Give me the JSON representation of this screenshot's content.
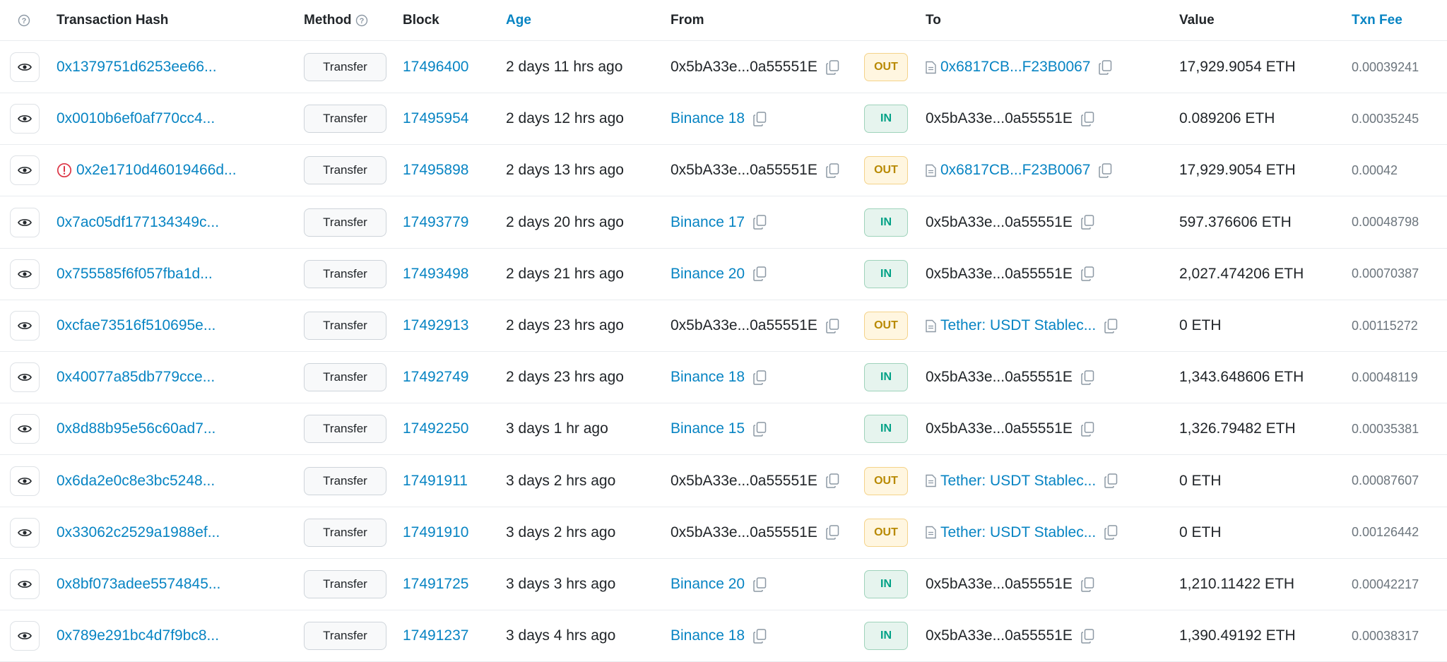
{
  "header": {
    "help_icon": "question-circle-icon",
    "hash": "Transaction Hash",
    "method": "Method",
    "block": "Block",
    "age": "Age",
    "from": "From",
    "to": "To",
    "value": "Value",
    "fee": "Txn Fee"
  },
  "colors": {
    "link": "#0784c3",
    "out": "#b88900",
    "in": "#00a186",
    "error": "#dc3545"
  },
  "rows": [
    {
      "hash": "0x1379751d6253ee66...",
      "error": false,
      "method": "Transfer",
      "block": "17496400",
      "age": "2 days 11 hrs ago",
      "from": "0x5bA33e...0a55551E",
      "from_link": false,
      "dir": "OUT",
      "to": "0x6817CB...F23B0067",
      "to_contract": true,
      "to_link": true,
      "value": "17,929.9054 ETH",
      "fee": "0.00039241"
    },
    {
      "hash": "0x0010b6ef0af770cc4...",
      "error": false,
      "method": "Transfer",
      "block": "17495954",
      "age": "2 days 12 hrs ago",
      "from": "Binance 18",
      "from_link": true,
      "dir": "IN",
      "to": "0x5bA33e...0a55551E",
      "to_contract": false,
      "to_link": false,
      "value": "0.089206 ETH",
      "fee": "0.00035245"
    },
    {
      "hash": "0x2e1710d46019466d...",
      "error": true,
      "method": "Transfer",
      "block": "17495898",
      "age": "2 days 13 hrs ago",
      "from": "0x5bA33e...0a55551E",
      "from_link": false,
      "dir": "OUT",
      "to": "0x6817CB...F23B0067",
      "to_contract": true,
      "to_link": true,
      "value": "17,929.9054 ETH",
      "fee": "0.00042"
    },
    {
      "hash": "0x7ac05df177134349c...",
      "error": false,
      "method": "Transfer",
      "block": "17493779",
      "age": "2 days 20 hrs ago",
      "from": "Binance 17",
      "from_link": true,
      "dir": "IN",
      "to": "0x5bA33e...0a55551E",
      "to_contract": false,
      "to_link": false,
      "value": "597.376606 ETH",
      "fee": "0.00048798"
    },
    {
      "hash": "0x755585f6f057fba1d...",
      "error": false,
      "method": "Transfer",
      "block": "17493498",
      "age": "2 days 21 hrs ago",
      "from": "Binance 20",
      "from_link": true,
      "dir": "IN",
      "to": "0x5bA33e...0a55551E",
      "to_contract": false,
      "to_link": false,
      "value": "2,027.474206 ETH",
      "fee": "0.00070387"
    },
    {
      "hash": "0xcfae73516f510695e...",
      "error": false,
      "method": "Transfer",
      "block": "17492913",
      "age": "2 days 23 hrs ago",
      "from": "0x5bA33e...0a55551E",
      "from_link": false,
      "dir": "OUT",
      "to": "Tether: USDT Stablec...",
      "to_contract": true,
      "to_link": true,
      "value": "0 ETH",
      "fee": "0.00115272"
    },
    {
      "hash": "0x40077a85db779cce...",
      "error": false,
      "method": "Transfer",
      "block": "17492749",
      "age": "2 days 23 hrs ago",
      "from": "Binance 18",
      "from_link": true,
      "dir": "IN",
      "to": "0x5bA33e...0a55551E",
      "to_contract": false,
      "to_link": false,
      "value": "1,343.648606 ETH",
      "fee": "0.00048119"
    },
    {
      "hash": "0x8d88b95e56c60ad7...",
      "error": false,
      "method": "Transfer",
      "block": "17492250",
      "age": "3 days 1 hr ago",
      "from": "Binance 15",
      "from_link": true,
      "dir": "IN",
      "to": "0x5bA33e...0a55551E",
      "to_contract": false,
      "to_link": false,
      "value": "1,326.79482 ETH",
      "fee": "0.00035381"
    },
    {
      "hash": "0x6da2e0c8e3bc5248...",
      "error": false,
      "method": "Transfer",
      "block": "17491911",
      "age": "3 days 2 hrs ago",
      "from": "0x5bA33e...0a55551E",
      "from_link": false,
      "dir": "OUT",
      "to": "Tether: USDT Stablec...",
      "to_contract": true,
      "to_link": true,
      "value": "0 ETH",
      "fee": "0.00087607"
    },
    {
      "hash": "0x33062c2529a1988ef...",
      "error": false,
      "method": "Transfer",
      "block": "17491910",
      "age": "3 days 2 hrs ago",
      "from": "0x5bA33e...0a55551E",
      "from_link": false,
      "dir": "OUT",
      "to": "Tether: USDT Stablec...",
      "to_contract": true,
      "to_link": true,
      "value": "0 ETH",
      "fee": "0.00126442"
    },
    {
      "hash": "0x8bf073adee5574845...",
      "error": false,
      "method": "Transfer",
      "block": "17491725",
      "age": "3 days 3 hrs ago",
      "from": "Binance 20",
      "from_link": true,
      "dir": "IN",
      "to": "0x5bA33e...0a55551E",
      "to_contract": false,
      "to_link": false,
      "value": "1,210.11422 ETH",
      "fee": "0.00042217"
    },
    {
      "hash": "0x789e291bc4d7f9bc8...",
      "error": false,
      "method": "Transfer",
      "block": "17491237",
      "age": "3 days 4 hrs ago",
      "from": "Binance 18",
      "from_link": true,
      "dir": "IN",
      "to": "0x5bA33e...0a55551E",
      "to_contract": false,
      "to_link": false,
      "value": "1,390.49192 ETH",
      "fee": "0.00038317"
    }
  ]
}
